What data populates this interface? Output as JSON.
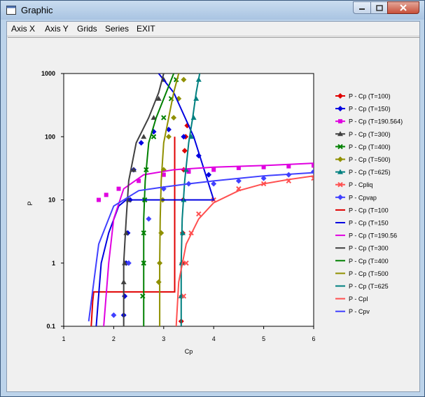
{
  "window": {
    "title": "Graphic",
    "icon": "app-window-icon"
  },
  "menu": [
    "Axis X",
    "Axis Y",
    "Grids",
    "Series",
    "EXIT"
  ],
  "chart_data": {
    "type": "scatter",
    "xlabel": "Cp",
    "ylabel": "P",
    "xlim": [
      1,
      6
    ],
    "ylim": [
      0.1,
      1000
    ],
    "yscale": "log",
    "x_ticks": [
      "1",
      "2",
      "3",
      "4",
      "5",
      "6"
    ],
    "y_ticks": [
      "0.1",
      "1",
      "10",
      "100",
      "1000"
    ],
    "legend_position": "right",
    "series": [
      {
        "name": "P - Cp (T=100)",
        "color": "#e00000",
        "kind": "points",
        "marker": "diamond",
        "x": [
          3.35,
          3.36,
          3.37,
          3.38,
          3.39,
          3.4,
          3.42,
          3.44,
          3.47
        ],
        "y": [
          0.12,
          0.3,
          1,
          3,
          10,
          30,
          60,
          100,
          150
        ]
      },
      {
        "name": "P - Cp (T=150)",
        "color": "#0000e0",
        "kind": "points",
        "marker": "diamond",
        "x": [
          2.2,
          2.22,
          2.25,
          2.28,
          2.33,
          2.4,
          2.55,
          2.8,
          3.1,
          3.4,
          3.7,
          3.9
        ],
        "y": [
          0.15,
          0.3,
          1,
          3,
          10,
          30,
          80,
          120,
          130,
          100,
          50,
          25
        ]
      },
      {
        "name": "P - Cp (T=190.564)",
        "color": "#e000e0",
        "kind": "points",
        "marker": "square",
        "x": [
          1.7,
          1.85,
          2.1,
          2.5,
          3.0,
          3.5,
          4.0,
          4.5,
          5.0,
          5.5,
          6.0
        ],
        "y": [
          10,
          12,
          15,
          20,
          25,
          28,
          30,
          32,
          33,
          34,
          35
        ]
      },
      {
        "name": "P - Cp (T=300)",
        "color": "#404040",
        "kind": "points",
        "marker": "triangle",
        "x": [
          2.2,
          2.22,
          2.25,
          2.3,
          2.4,
          2.6,
          2.8,
          2.9,
          3.0
        ],
        "y": [
          0.5,
          1,
          3,
          10,
          30,
          100,
          200,
          400,
          800
        ]
      },
      {
        "name": "P - Cp (T=400)",
        "color": "#008000",
        "kind": "points",
        "marker": "cross",
        "x": [
          2.58,
          2.6,
          2.6,
          2.62,
          2.65,
          2.8,
          3.0,
          3.15,
          3.25
        ],
        "y": [
          0.3,
          1,
          3,
          10,
          30,
          100,
          200,
          400,
          800
        ]
      },
      {
        "name": "P - Cp (T=500)",
        "color": "#909000",
        "kind": "points",
        "marker": "diamond",
        "x": [
          2.9,
          2.92,
          2.95,
          2.98,
          3.0,
          3.1,
          3.2,
          3.3,
          3.4
        ],
        "y": [
          0.5,
          1,
          3,
          10,
          30,
          100,
          200,
          400,
          800
        ]
      },
      {
        "name": "P - Cp (T=625)",
        "color": "#008080",
        "kind": "points",
        "marker": "triangle",
        "x": [
          3.35,
          3.36,
          3.38,
          3.4,
          3.45,
          3.55,
          3.6,
          3.65,
          3.7
        ],
        "y": [
          0.3,
          1,
          3,
          10,
          30,
          100,
          200,
          400,
          800
        ]
      },
      {
        "name": "P - Cpliq",
        "color": "#ff5050",
        "kind": "points",
        "marker": "cross",
        "x": [
          3.4,
          3.45,
          3.55,
          3.7,
          4.0,
          4.5,
          5.0,
          5.5,
          6.0
        ],
        "y": [
          0.3,
          1,
          3,
          6,
          10,
          15,
          18,
          20,
          22
        ]
      },
      {
        "name": "P - Cpvap",
        "color": "#4040ff",
        "kind": "points",
        "marker": "diamond",
        "x": [
          2.0,
          2.3,
          2.7,
          3.0,
          3.5,
          4.0,
          4.5,
          5.0,
          5.5,
          6.0
        ],
        "y": [
          0.15,
          1,
          5,
          15,
          18,
          18,
          20,
          22,
          25,
          28
        ]
      },
      {
        "name": "P - Cp (T=100",
        "color": "#e00000",
        "kind": "line",
        "x": [
          1.55,
          1.58,
          1.6,
          3.22,
          3.22,
          3.22
        ],
        "y": [
          0.1,
          0.25,
          0.35,
          0.35,
          10,
          100
        ]
      },
      {
        "name": "P - Cp (T=150",
        "color": "#0000e0",
        "kind": "line",
        "x": [
          1.65,
          1.75,
          1.9,
          2.1,
          2.25,
          4.0,
          3.6,
          3.2,
          2.9
        ],
        "y": [
          0.1,
          1,
          3,
          8,
          10,
          10,
          100,
          500,
          1000
        ]
      },
      {
        "name": "P - Cp (T=190.56",
        "color": "#e000e0",
        "kind": "line",
        "x": [
          1.8,
          1.9,
          2.0,
          2.2,
          2.6,
          3.2,
          4.0,
          5.0,
          6.0
        ],
        "y": [
          0.1,
          1,
          5,
          15,
          25,
          30,
          33,
          35,
          38
        ]
      },
      {
        "name": "P - Cp (T=300",
        "color": "#404040",
        "kind": "line",
        "x": [
          2.2,
          2.2,
          2.25,
          2.3,
          2.45,
          2.7,
          2.9,
          3.0
        ],
        "y": [
          0.1,
          1,
          5,
          20,
          80,
          200,
          500,
          1000
        ]
      },
      {
        "name": "P - Cp (T=400",
        "color": "#008000",
        "kind": "line",
        "x": [
          2.6,
          2.6,
          2.6,
          2.63,
          2.7,
          2.85,
          3.05,
          3.2
        ],
        "y": [
          0.1,
          1,
          5,
          20,
          80,
          200,
          500,
          1000
        ]
      },
      {
        "name": "P - Cp (T=500",
        "color": "#909000",
        "kind": "line",
        "x": [
          2.92,
          2.92,
          2.93,
          2.95,
          3.0,
          3.1,
          3.2,
          3.3
        ],
        "y": [
          0.1,
          1,
          5,
          20,
          80,
          200,
          500,
          1000
        ]
      },
      {
        "name": "P - Cp (T=625",
        "color": "#008080",
        "kind": "line",
        "x": [
          3.35,
          3.35,
          3.37,
          3.42,
          3.5,
          3.58,
          3.65,
          3.72
        ],
        "y": [
          0.1,
          1,
          5,
          20,
          80,
          200,
          500,
          1000
        ]
      },
      {
        "name": "P - Cpl",
        "color": "#ff5050",
        "kind": "line",
        "x": [
          3.25,
          3.3,
          3.45,
          3.7,
          4.0,
          4.5,
          5.0,
          5.5,
          6.0
        ],
        "y": [
          0.1,
          0.5,
          2,
          5,
          9,
          14,
          18,
          21,
          24
        ]
      },
      {
        "name": "P - Cpv",
        "color": "#4040ff",
        "kind": "line",
        "x": [
          1.5,
          1.7,
          2.0,
          2.5,
          3.0,
          3.5,
          4.0,
          5.0,
          6.0
        ],
        "y": [
          0.12,
          2,
          8,
          14,
          16,
          18,
          20,
          24,
          27
        ]
      }
    ]
  }
}
